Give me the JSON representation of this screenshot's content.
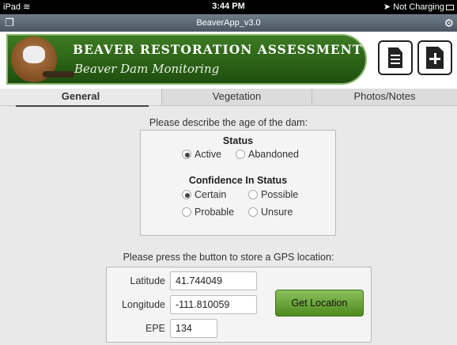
{
  "statusbar": {
    "device": "iPad",
    "time": "3:44 PM",
    "charging": "Not Charging"
  },
  "app": {
    "window_title": "BeaverApp_v3.0"
  },
  "banner": {
    "title": "BEAVER RESTORATION ASSESSMENT TOOL",
    "subtitle": "Beaver Dam Monitoring"
  },
  "tabs": [
    {
      "label": "General"
    },
    {
      "label": "Vegetation"
    },
    {
      "label": "Photos/Notes"
    }
  ],
  "age_prompt": "Please describe the age of the dam:",
  "status_section": {
    "title": "Status",
    "options": [
      {
        "label": "Active",
        "selected": true
      },
      {
        "label": "Abandoned",
        "selected": false
      }
    ]
  },
  "confidence_section": {
    "title": "Confidence In Status",
    "options": [
      {
        "label": "Certain",
        "selected": true
      },
      {
        "label": "Possible",
        "selected": false
      },
      {
        "label": "Probable",
        "selected": false
      },
      {
        "label": "Unsure",
        "selected": false
      }
    ]
  },
  "gps_prompt": "Please press the button to store a GPS location:",
  "gps": {
    "latitude_label": "Latitude",
    "latitude_value": "41.744049",
    "longitude_label": "Longitude",
    "longitude_value": "-111.810059",
    "epe_label": "EPE",
    "epe_value": "134",
    "button_label": "Get Location"
  },
  "colors": {
    "banner_green": "#2f6a17",
    "button_green": "#6aa63a"
  },
  "icons": {
    "window_left": "copy-icon",
    "window_right": "gear-icon",
    "new_doc": "document-icon",
    "add_doc": "add-document-icon"
  }
}
